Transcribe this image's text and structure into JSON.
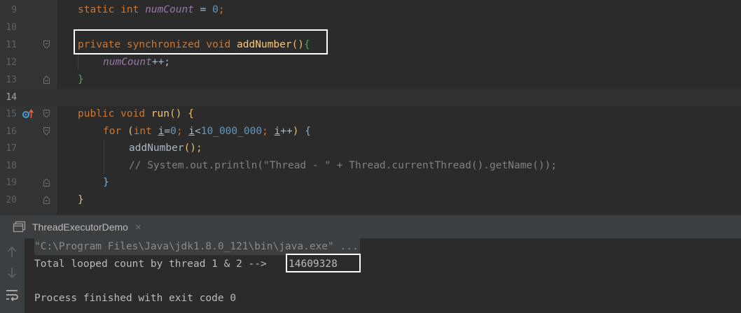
{
  "editor": {
    "lines": [
      {
        "num": "9"
      },
      {
        "num": "10"
      },
      {
        "num": "11"
      },
      {
        "num": "12"
      },
      {
        "num": "13"
      },
      {
        "num": "14"
      },
      {
        "num": "15"
      },
      {
        "num": "16"
      },
      {
        "num": "17"
      },
      {
        "num": "18"
      },
      {
        "num": "19"
      },
      {
        "num": "20"
      }
    ],
    "code": {
      "l9": {
        "kw1": "static",
        "kw2": "int",
        "field": "numCount",
        "op": " = ",
        "num": "0",
        "end": ";"
      },
      "l11": {
        "kw1": "private",
        "kw2": "synchronized",
        "kw3": "void",
        "method": "addNumber",
        "paren": "()",
        "brace": "{"
      },
      "l12": {
        "field": "numCount",
        "rest": "++;"
      },
      "l13": {
        "brace": "}"
      },
      "l15": {
        "kw1": "public",
        "kw2": "void",
        "method": "run",
        "paren": "()",
        "brace": "{"
      },
      "l16": {
        "kw1": "for",
        "open": "(",
        "kw2": "int",
        "var1": "i",
        "eq": "=",
        "n1": "0",
        "semi1": ";",
        "var2": "i",
        "lt": "<",
        "n2": "10_000_000",
        "semi2": ";",
        "var3": "i",
        "inc": "++",
        "close": ")",
        "brace": "{"
      },
      "l17": {
        "call": "addNumber",
        "rest": "();"
      },
      "l18": {
        "comment": "// System.out.println(\"Thread - \" + Thread.currentThread().getName());"
      },
      "l19": {
        "brace": "}"
      },
      "l20": {
        "brace": "}"
      }
    }
  },
  "run_panel": {
    "tab_label": "ThreadExecutorDemo",
    "tab_close": "×",
    "console": {
      "command": "\"C:\\Program Files\\Java\\jdk1.8.0_121\\bin\\java.exe\" ...",
      "output_prefix": "Total looped count by thread 1 & 2 -->",
      "output_value": "14609328",
      "exit_message": "Process finished with exit code 0"
    },
    "tools": [
      "arrow-up-icon",
      "arrow-down-icon",
      "soft-wrap-icon"
    ]
  },
  "colors": {
    "background": "#2b2b2b",
    "keyword": "#cc7832",
    "field": "#9876aa",
    "number": "#6897bb",
    "method": "#ffc66d",
    "comment": "#808080",
    "text": "#a9b7c6",
    "highlight_box": "#ffffff"
  }
}
